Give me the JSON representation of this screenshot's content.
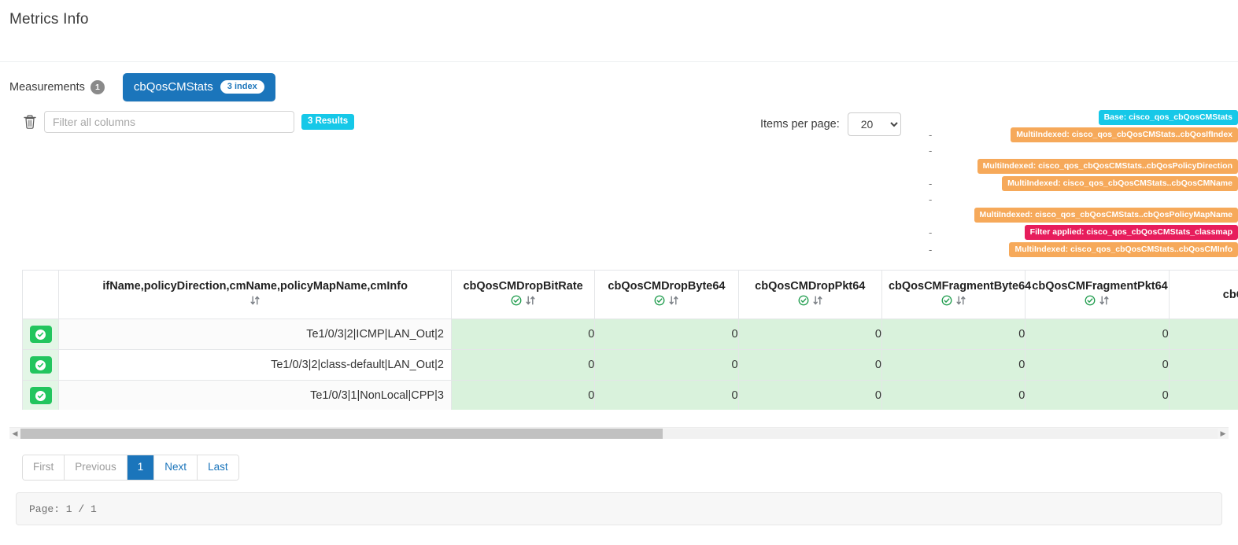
{
  "page_title": "Metrics Info",
  "measurements": {
    "label": "Measurements",
    "count": "1",
    "chips": [
      {
        "name": "cbQosCMStats",
        "index_label": "3 index"
      }
    ]
  },
  "controls": {
    "trash_icon": "trash-icon",
    "filter_placeholder": "Filter all columns",
    "filter_value": "",
    "results_badge": "3 Results",
    "items_per_page_label": "Items per page:",
    "items_per_page_value": "20",
    "items_per_page_options": [
      "20"
    ]
  },
  "index_badges": [
    {
      "dash": false,
      "text": "Base: cisco_qos_cbQosCMStats",
      "kind": "base",
      "indent": 0
    },
    {
      "dash": true,
      "text": "MultiIndexed: cisco_qos_cbQosCMStats..cbQosIfIndex",
      "kind": "multi",
      "indent": 0
    },
    {
      "dash": true,
      "text": "",
      "kind": "none",
      "indent": 0
    },
    {
      "dash": false,
      "text": "MultiIndexed: cisco_qos_cbQosCMStats..cbQosPolicyDirection",
      "kind": "multi",
      "indent": 0
    },
    {
      "dash": true,
      "text": "MultiIndexed: cisco_qos_cbQosCMStats..cbQosCMName",
      "kind": "multi",
      "indent": 0
    },
    {
      "dash": true,
      "text": "",
      "kind": "none",
      "indent": 0
    },
    {
      "dash": false,
      "text": "MultiIndexed: cisco_qos_cbQosCMStats..cbQosPolicyMapName",
      "kind": "multi",
      "indent": 0
    },
    {
      "dash": true,
      "text": "Filter applied: cisco_qos_cbQosCMStats_classmap",
      "kind": "filterapplied",
      "indent": 0
    },
    {
      "dash": true,
      "text": "MultiIndexed: cisco_qos_cbQosCMStats..cbQosCMInfo",
      "kind": "multi",
      "indent": 0
    }
  ],
  "table": {
    "columns": [
      {
        "label": "",
        "type": "select"
      },
      {
        "label": "ifName,policyDirection,cmName,policyMapName,cmInfo",
        "type": "key",
        "sortable": true,
        "checked": false
      },
      {
        "label": "cbQosCMDropBitRate",
        "type": "num",
        "sortable": true,
        "checked": true
      },
      {
        "label": "cbQosCMDropByte64",
        "type": "num",
        "sortable": true,
        "checked": true
      },
      {
        "label": "cbQosCMDropPkt64",
        "type": "num",
        "sortable": true,
        "checked": true
      },
      {
        "label": "cbQosCMFragmentByte64",
        "type": "num",
        "sortable": true,
        "checked": true
      },
      {
        "label": "cbQosCMFragmentPkt64",
        "type": "num",
        "sortable": true,
        "checked": true
      },
      {
        "label": "cbQos",
        "type": "num",
        "sortable": false,
        "checked": false
      }
    ],
    "rows": [
      {
        "key": "Te1/0/3|2|ICMP|LAN_Out|2",
        "values": [
          "0",
          "0",
          "0",
          "0",
          "0",
          ""
        ]
      },
      {
        "key": "Te1/0/3|2|class-default|LAN_Out|2",
        "values": [
          "0",
          "0",
          "0",
          "0",
          "0",
          ""
        ]
      },
      {
        "key": "Te1/0/3|1|NonLocal|CPP|3",
        "values": [
          "0",
          "0",
          "0",
          "0",
          "0",
          ""
        ]
      }
    ]
  },
  "pagination": {
    "buttons": [
      {
        "label": "First",
        "state": "disabled"
      },
      {
        "label": "Previous",
        "state": "disabled"
      },
      {
        "label": "1",
        "state": "active"
      },
      {
        "label": "Next",
        "state": "link"
      },
      {
        "label": "Last",
        "state": "link"
      }
    ]
  },
  "status": {
    "text": "Page: 1 / 1"
  },
  "colors": {
    "brand_blue": "#1b75bb",
    "cyan": "#16c8e8",
    "orange": "#f6a95a",
    "pink": "#e71d5c",
    "green_row": "#d9f2dc",
    "green_button": "#22c55e"
  }
}
